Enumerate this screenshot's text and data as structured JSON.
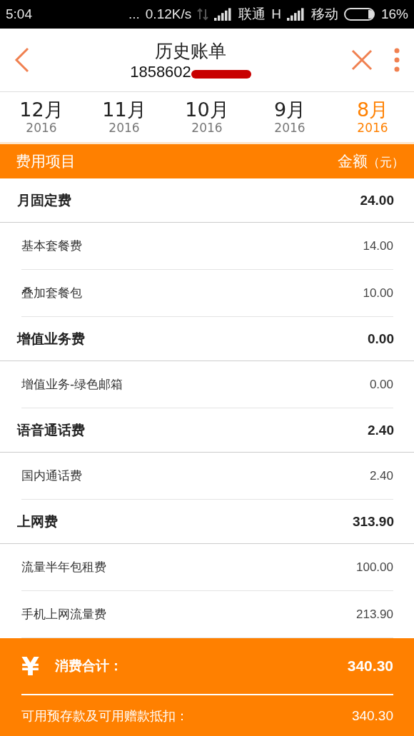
{
  "status_bar": {
    "time": "5:04",
    "dots": "...",
    "speed": "0.12K/s",
    "carrier_1": "联通",
    "network_1": "H",
    "carrier_2": "移动",
    "battery": "16%"
  },
  "header": {
    "title": "历史账单",
    "phone": "1858602"
  },
  "months": [
    {
      "month": "12月",
      "year": "2016",
      "selected": false
    },
    {
      "month": "11月",
      "year": "2016",
      "selected": false
    },
    {
      "month": "10月",
      "year": "2016",
      "selected": false
    },
    {
      "month": "9月",
      "year": "2016",
      "selected": false
    },
    {
      "month": "8月",
      "year": "2016",
      "selected": true
    }
  ],
  "table": {
    "columns": [
      "费用项目",
      "金额"
    ],
    "unit": "（元）",
    "rows": [
      {
        "kind": "group",
        "name": "月固定费",
        "amount": "24.00"
      },
      {
        "kind": "item",
        "name": "基本套餐费",
        "amount": "14.00"
      },
      {
        "kind": "item",
        "name": "叠加套餐包",
        "amount": "10.00"
      },
      {
        "kind": "group",
        "name": "增值业务费",
        "amount": "0.00"
      },
      {
        "kind": "item",
        "name": "增值业务-绿色邮箱",
        "amount": "0.00"
      },
      {
        "kind": "group",
        "name": "语音通话费",
        "amount": "2.40"
      },
      {
        "kind": "item",
        "name": "国内通话费",
        "amount": "2.40"
      },
      {
        "kind": "group",
        "name": "上网费",
        "amount": "313.90"
      },
      {
        "kind": "item",
        "name": "流量半年包租费",
        "amount": "100.00"
      },
      {
        "kind": "item",
        "name": "手机上网流量费",
        "amount": "213.90"
      }
    ]
  },
  "summary": {
    "symbol": "¥",
    "total_label": "消费合计：",
    "total": "340.30",
    "deduct_label": "可用预存款及可用赠款抵扣：",
    "deduct": "340.30"
  }
}
